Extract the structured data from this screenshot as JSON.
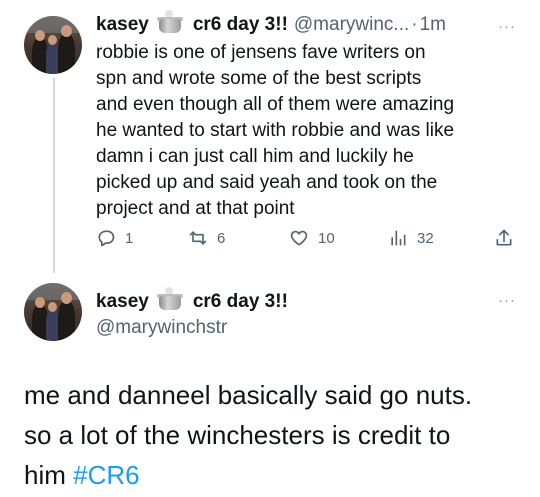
{
  "tweet1": {
    "name": "kasey",
    "display_suffix": "cr6 day 3!!",
    "handle": "@marywinc...",
    "dot": "·",
    "time": "1m",
    "more": "···",
    "body_lines": [
      "robbie is one of jensens fave writers on",
      "spn and wrote some of the best scripts",
      "and even though all of them were amazing",
      "he wanted to start with robbie and was like",
      "damn i can just call him and luckily he",
      "picked up and said yeah and took on the",
      "project and at that point"
    ],
    "actions": {
      "reply_count": "1",
      "retweet_count": "6",
      "like_count": "10",
      "views_count": "32"
    }
  },
  "tweet2": {
    "name": "kasey",
    "display_suffix": "cr6 day 3!!",
    "handle": "@marywinchstr",
    "more": "···",
    "body_lines": [
      "me and danneel basically said go nuts.",
      "so a lot of the winchesters is credit to"
    ],
    "last_line_prefix": "him",
    "hashtag": "#CR6"
  },
  "icons": {
    "name_emoji": "funeral-urn-emoji",
    "reply": "reply-icon",
    "retweet": "retweet-icon",
    "like": "heart-icon",
    "views": "views-bar-icon",
    "share": "share-icon"
  },
  "colors": {
    "text": "#0f1419",
    "secondary": "#536471",
    "hashtag": "#1d9bf0",
    "thread_line": "#cfd9de"
  }
}
